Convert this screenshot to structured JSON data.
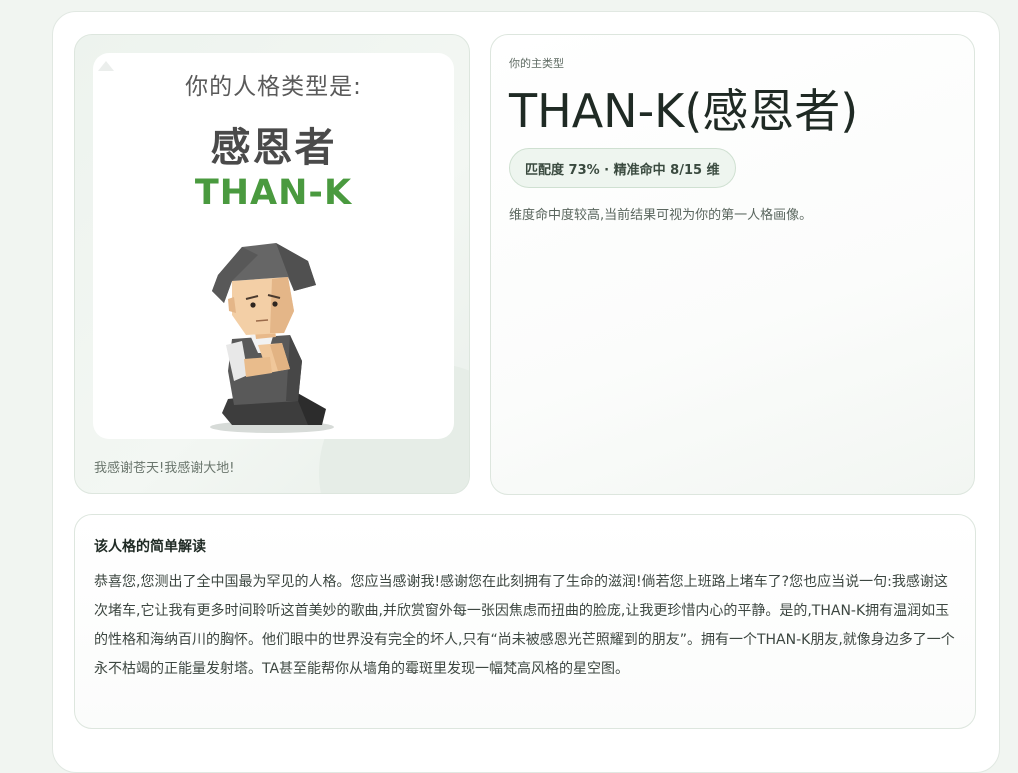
{
  "poster": {
    "heading": "你的人格类型是:",
    "name": "感恩者",
    "code": "THAN-K",
    "caption": "我感谢苍天!我感谢大地!"
  },
  "summary": {
    "kicker": "你的主类型",
    "title": "THAN-K(感恩者)",
    "badge": "匹配度 73% · 精准命中 8/15 维",
    "description": "维度命中度较高,当前结果可视为你的第一人格画像。"
  },
  "reading": {
    "title": "该人格的简单解读",
    "body": "恭喜您,您测出了全中国最为罕见的人格。您应当感谢我!感谢您在此刻拥有了生命的滋润!倘若您上班路上堵车了?您也应当说一句:我感谢这次堵车,它让我有更多时间聆听这首美妙的歌曲,并欣赏窗外每一张因焦虑而扭曲的脸庞,让我更珍惜内心的平静。是的,THAN-K拥有温润如玉的性格和海纳百川的胸怀。他们眼中的世界没有完全的坏人,只有“尚未被感恩光芒照耀到的朋友”。拥有一个THAN-K朋友,就像身边多了一个永不枯竭的正能量发射塔。TA甚至能帮你从墙角的霉斑里发现一幅梵高风格的星空图。"
  },
  "icons": {
    "character": "praying-character-icon",
    "watermark": "watermark-icon"
  },
  "colors": {
    "accent_green": "#4a9a3f",
    "page_background": "#f1f5f1",
    "badge_background": "#eef5ef"
  }
}
